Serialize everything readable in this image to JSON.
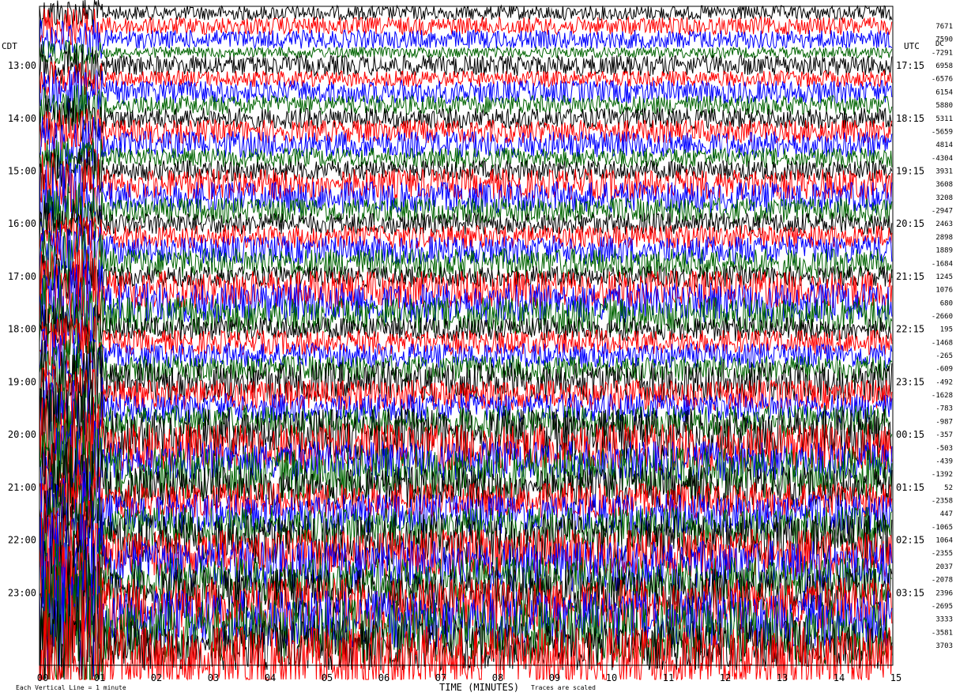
{
  "chart_data": {
    "type": "line",
    "left_axis_label": "CDT",
    "right_axis_label": "UTC",
    "dc_label": "DC",
    "xlabel": "TIME (MINUTES)",
    "x_ticks": [
      "00",
      "01",
      "02",
      "03",
      "04",
      "05",
      "06",
      "07",
      "08",
      "09",
      "10",
      "11",
      "12",
      "13",
      "14",
      "15"
    ],
    "x_range_minutes": [
      0,
      15
    ],
    "row_minutes": 15,
    "left_hour_labels": [
      "13:00",
      "14:00",
      "15:00",
      "16:00",
      "17:00",
      "18:00",
      "19:00",
      "20:00",
      "21:00",
      "22:00",
      "23:00"
    ],
    "right_hour_labels": [
      "17:15",
      "18:15",
      "19:15",
      "20:15",
      "21:15",
      "22:15",
      "23:15",
      "00:15",
      "01:15",
      "02:15",
      "03:15"
    ],
    "dc_offsets": [
      "7671",
      "7590",
      "-7291",
      "6958",
      "-6576",
      "6154",
      "5880",
      "5311",
      "-5659",
      "4814",
      "-4304",
      "3931",
      "3608",
      "3208",
      "-2947",
      "2463",
      "2898",
      "1889",
      "-1684",
      "1245",
      "1076",
      "680",
      "-2660",
      "195",
      "-1468",
      "-265",
      "-609",
      "-492",
      "-1628",
      "-783",
      "-987",
      "-357",
      "-503",
      "-439",
      "-1392",
      "52",
      "-2358",
      "447",
      "-1065",
      "1064",
      "-2355",
      "2037",
      "-2078",
      "2396",
      "-2695",
      "3333",
      "-3581",
      "3703"
    ],
    "trace_colors": [
      "#000000",
      "#ff0000",
      "#0000ff",
      "#006400"
    ],
    "footer_left": "Each Vertical Line = 1 minute",
    "footer_right": "Traces are scaled"
  }
}
